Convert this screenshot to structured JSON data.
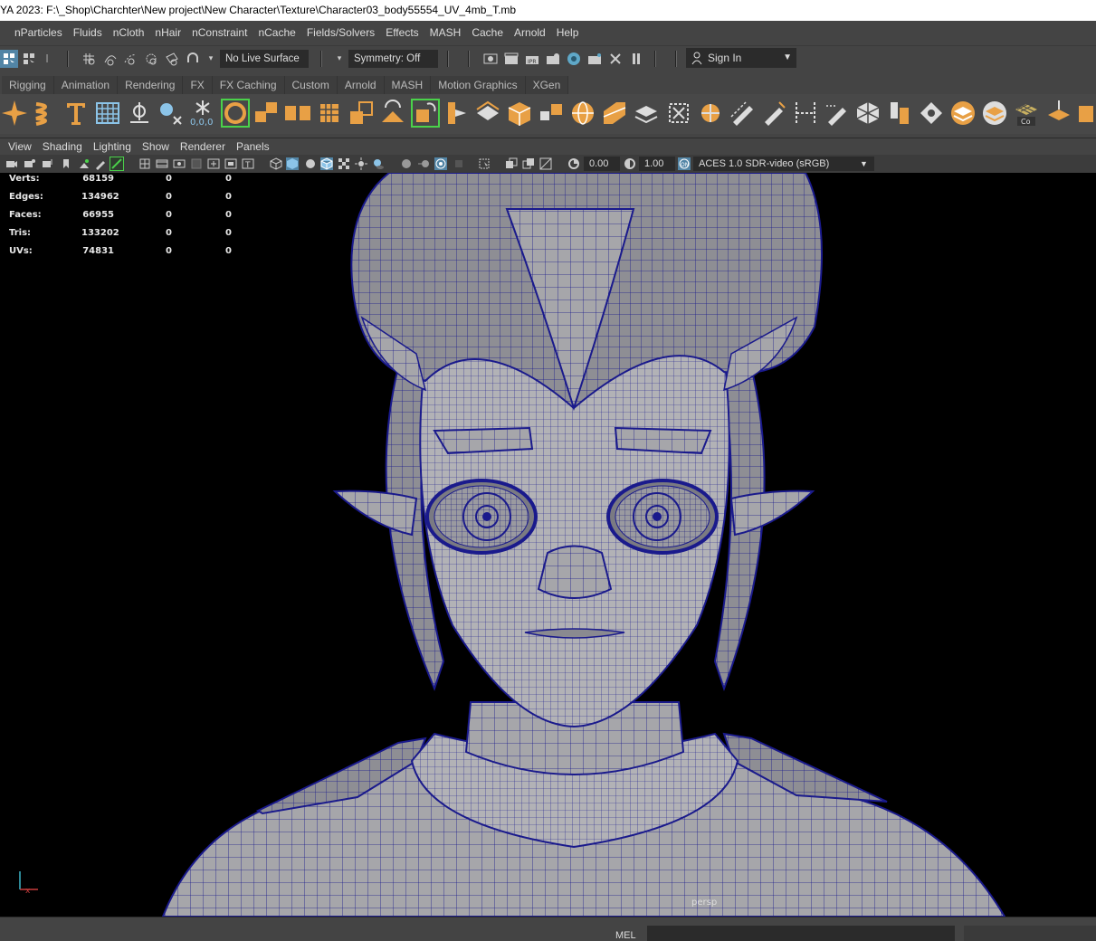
{
  "window": {
    "title": "YA 2023: F:\\_Shop\\Charchter\\New project\\New Character\\Texture\\Character03_body55554_UV_4mb_T.mb"
  },
  "menubar": {
    "items": [
      "nParticles",
      "Fluids",
      "nCloth",
      "nHair",
      "nConstraint",
      "nCache",
      "Fields/Solvers",
      "Effects",
      "MASH",
      "Cache",
      "Arnold",
      "Help"
    ]
  },
  "statusline": {
    "live_surface": "No Live Surface",
    "symmetry": "Symmetry: Off",
    "sign_in": "Sign In"
  },
  "shelf": {
    "tabs": [
      "Rigging",
      "Animation",
      "Rendering",
      "FX",
      "FX Caching",
      "Custom",
      "Arnold",
      "MASH",
      "Motion Graphics",
      "XGen"
    ],
    "snap_label": "0,0,0",
    "co_label": "Co"
  },
  "panel": {
    "menu": [
      "View",
      "Shading",
      "Lighting",
      "Show",
      "Renderer",
      "Panels"
    ],
    "exposure": "0.00",
    "gamma": "1.00",
    "color_space": "ACES 1.0 SDR-video (sRGB)"
  },
  "hud": {
    "rows": [
      {
        "label": "Verts:",
        "v1": "68159",
        "v2": "0",
        "v3": "0"
      },
      {
        "label": "Edges:",
        "v1": "134962",
        "v2": "0",
        "v3": "0"
      },
      {
        "label": "Faces:",
        "v1": "66955",
        "v2": "0",
        "v3": "0"
      },
      {
        "label": "Tris:",
        "v1": "133202",
        "v2": "0",
        "v3": "0"
      },
      {
        "label": "UVs:",
        "v1": "74831",
        "v2": "0",
        "v3": "0"
      }
    ],
    "camera": "persp"
  },
  "commandline": {
    "mode": "MEL"
  },
  "colors": {
    "accent": "#e8a045",
    "wire": "#1a1a8c",
    "mesh": "#a9a9ad",
    "select_green": "#4ad24a"
  }
}
